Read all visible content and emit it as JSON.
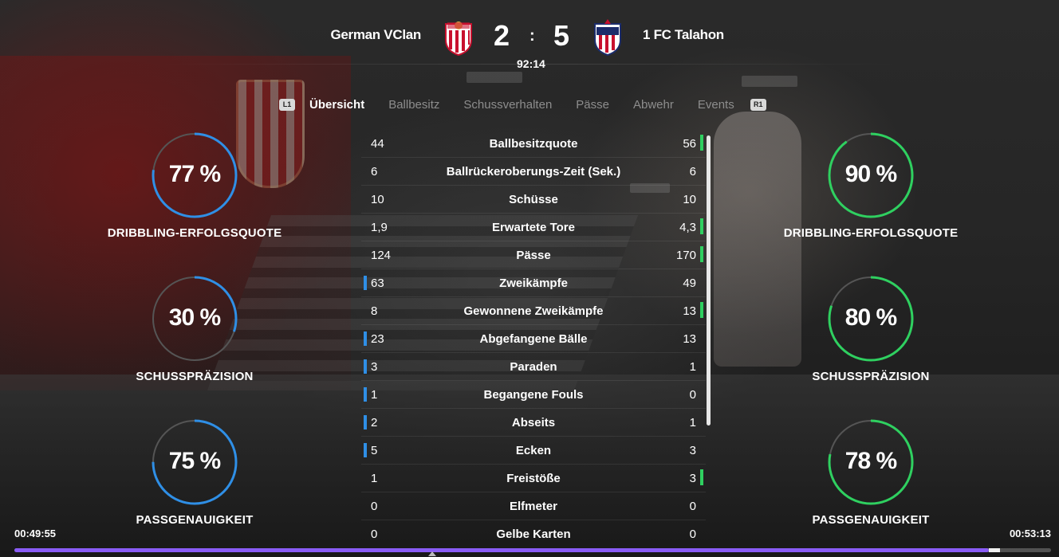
{
  "header": {
    "home_team": "German VClan",
    "away_team": "1 FC Talahon",
    "home_score": "2",
    "away_score": "5",
    "separator": ":",
    "match_time": "92:14"
  },
  "tabs": {
    "left_button": "L1",
    "right_button": "R1",
    "items": [
      "Übersicht",
      "Ballbesitz",
      "Schussverhalten",
      "Pässe",
      "Abwehr",
      "Events"
    ],
    "active_index": 0
  },
  "home_rings": [
    {
      "value_text": "77 %",
      "percent": 77,
      "label": "DRIBBLING-ERFOLGSQUOTE"
    },
    {
      "value_text": "30 %",
      "percent": 30,
      "label": "SCHUSSPRÄZISION"
    },
    {
      "value_text": "75 %",
      "percent": 75,
      "label": "PASSGENAUIGKEIT"
    }
  ],
  "away_rings": [
    {
      "value_text": "90 %",
      "percent": 90,
      "label": "DRIBBLING-ERFOLGSQUOTE"
    },
    {
      "value_text": "80 %",
      "percent": 80,
      "label": "SCHUSSPRÄZISION"
    },
    {
      "value_text": "78 %",
      "percent": 78,
      "label": "PASSGENAUIGKEIT"
    }
  ],
  "stats": [
    {
      "name": "Ballbesitzquote",
      "home": "44",
      "away": "56",
      "leader": "away"
    },
    {
      "name": "Ballrückeroberungs-Zeit (Sek.)",
      "home": "6",
      "away": "6",
      "leader": ""
    },
    {
      "name": "Schüsse",
      "home": "10",
      "away": "10",
      "leader": ""
    },
    {
      "name": "Erwartete Tore",
      "home": "1,9",
      "away": "4,3",
      "leader": "away"
    },
    {
      "name": "Pässe",
      "home": "124",
      "away": "170",
      "leader": "away"
    },
    {
      "name": "Zweikämpfe",
      "home": "63",
      "away": "49",
      "leader": "home"
    },
    {
      "name": "Gewonnene Zweikämpfe",
      "home": "8",
      "away": "13",
      "leader": "away"
    },
    {
      "name": "Abgefangene Bälle",
      "home": "23",
      "away": "13",
      "leader": "home"
    },
    {
      "name": "Paraden",
      "home": "3",
      "away": "1",
      "leader": "home"
    },
    {
      "name": "Begangene Fouls",
      "home": "1",
      "away": "0",
      "leader": "home"
    },
    {
      "name": "Abseits",
      "home": "2",
      "away": "1",
      "leader": "home"
    },
    {
      "name": "Ecken",
      "home": "5",
      "away": "3",
      "leader": "home"
    },
    {
      "name": "Freistöße",
      "home": "1",
      "away": "3",
      "leader": "away"
    },
    {
      "name": "Elfmeter",
      "home": "0",
      "away": "0",
      "leader": ""
    },
    {
      "name": "Gelbe Karten",
      "home": "0",
      "away": "0",
      "leader": ""
    }
  ],
  "player": {
    "elapsed": "00:49:55",
    "total": "00:53:13",
    "progress_fraction": 0.94
  },
  "colors": {
    "home_accent": "#2f8fe6",
    "away_accent": "#2fd060",
    "progress": "#8a5cf6"
  }
}
